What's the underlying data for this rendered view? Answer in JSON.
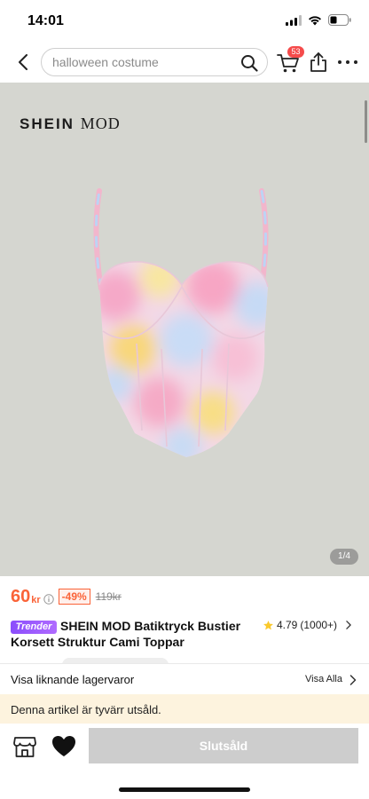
{
  "status_bar": {
    "time": "14:01"
  },
  "header": {
    "search_placeholder": "halloween costume",
    "cart_count": "53"
  },
  "gallery": {
    "brand_part1": "SHEIN",
    "brand_part2": "MOD",
    "image_counter": "1/4",
    "current_image": 1,
    "total_images": 4
  },
  "product": {
    "price": "60",
    "price_unit": "kr",
    "discount": "-49%",
    "original_price": "119kr",
    "badge": "Trender",
    "title": "SHEIN MOD Batiktryck Bustier Korsett Struktur Cami Toppar",
    "rating": "4.79",
    "rating_count": "(1000+)"
  },
  "similar": {
    "label": "Visa liknande lagervaror",
    "view_all": "Visa Alla"
  },
  "notice": {
    "soldout_text": "Denna artikel är tyvärr utsåld."
  },
  "bottom_bar": {
    "soldout_button": "Slutsåld"
  },
  "colors": {
    "accent_price": "#fa6338",
    "cart_badge": "#f54b4b",
    "trend_badge": "#8a4dfc",
    "gallery_bg": "#d5d6d0",
    "soldout_banner": "#fdf3de",
    "disabled_button": "#cdcdcd"
  },
  "icons": [
    "back-arrow-icon",
    "search-icon",
    "cart-icon",
    "share-icon",
    "more-icon",
    "info-icon",
    "star-icon",
    "chevron-right-icon",
    "store-icon",
    "heart-icon",
    "signal-icon",
    "wifi-icon",
    "battery-icon"
  ]
}
